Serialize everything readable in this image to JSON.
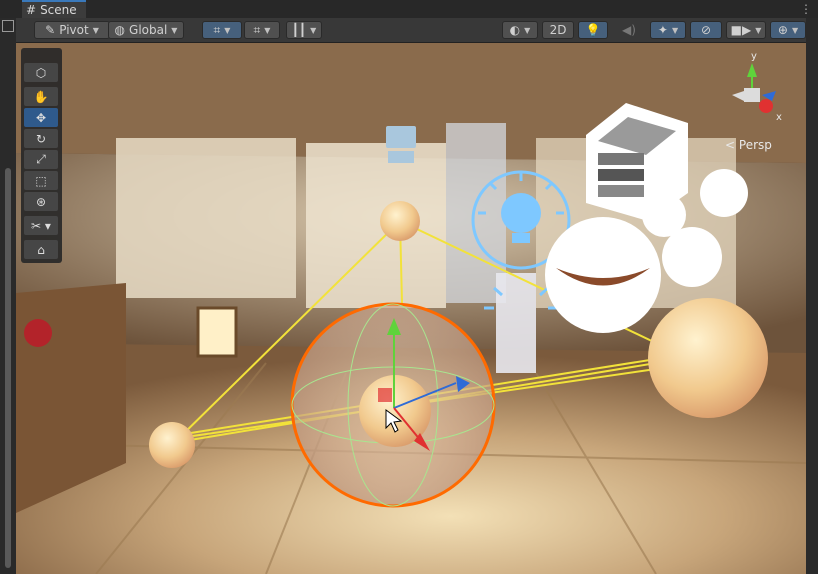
{
  "tab": {
    "title": "Scene"
  },
  "toolbar": {
    "pivot_label": "Pivot",
    "global_label": "Global",
    "mode_2d_label": "2D"
  },
  "scene": {
    "camera_label": "Persp",
    "gizmo_axes": [
      "y",
      "x"
    ]
  },
  "colors": {
    "accent": "#3a79bb",
    "toolbar_bg": "#383838",
    "selection_outline": "#ff6a00",
    "axis_x": "#e03131",
    "axis_y": "#5fd33b",
    "axis_z": "#2f6bd6",
    "light_icon": "#7ec8ff"
  },
  "tools": [
    "view-tool",
    "hand-tool",
    "move-tool",
    "rotate-tool",
    "scale-tool",
    "rect-tool",
    "transform-tool",
    "custom-tool",
    "component-tool"
  ],
  "icons": {
    "scene_tab": "grid-icon",
    "pivot": "pivot-icon",
    "global": "globe-icon",
    "light_toggle": "bulb-icon",
    "audio_toggle": "speaker-icon",
    "fx_toggle": "layers-icon",
    "visibility_toggle": "eye-slash-icon",
    "camera_toggle": "camera-icon",
    "gizmos_toggle": "gizmo-globe-icon"
  }
}
